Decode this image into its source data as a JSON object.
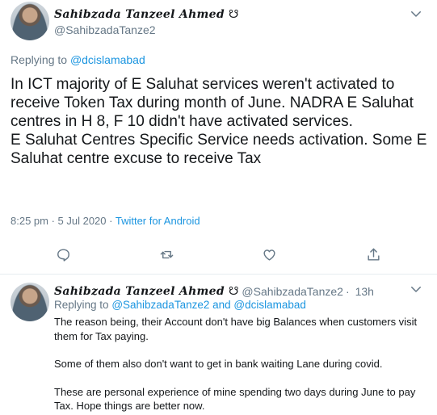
{
  "main_tweet": {
    "display_name": "Sahibzada Tanzeel Ahmed",
    "name_symbol": "☋",
    "handle": "@SahibzadaTanze2",
    "replying_prefix": "Replying to",
    "replying_to": "@dcislamabad",
    "text": "In ICT majority of E Saluhat services weren't activated to receive Token Tax during month of June. NADRA E Saluhat centres in H 8, F 10 didn't have activated services.\nE Saluhat Centres Specific Service needs activation. Some E Saluhat centre excuse to receive Tax",
    "timestamp": "8:25 pm · 5 Jul 2020 · ",
    "source": "Twitter for Android"
  },
  "actions": [
    "reply-icon",
    "retweet-icon",
    "like-icon",
    "share-icon"
  ],
  "reply_tweet": {
    "display_name": "Sahibzada Tanzeel Ahmed",
    "name_symbol": "☋",
    "handle": "@SahibzadaTanze2",
    "separator": "·",
    "age": "13h",
    "replying_prefix": "Replying to",
    "replying_to_1": "@SahibzadaTanze2",
    "replying_and": "and",
    "replying_to_2": "@dcislamabad",
    "paragraphs": [
      "The reason being, their Account don't have big Balances when customers visit them for Tax paying.",
      "Some of them also don't want to get in bank  waiting Lane during covid.",
      "These are personal experience of mine spending two days during June to pay Tax. Hope things are better now."
    ]
  },
  "colors": {
    "accent": "#1b95e0",
    "muted": "#657786",
    "text": "#14171a",
    "divider": "#e6ecf0"
  }
}
